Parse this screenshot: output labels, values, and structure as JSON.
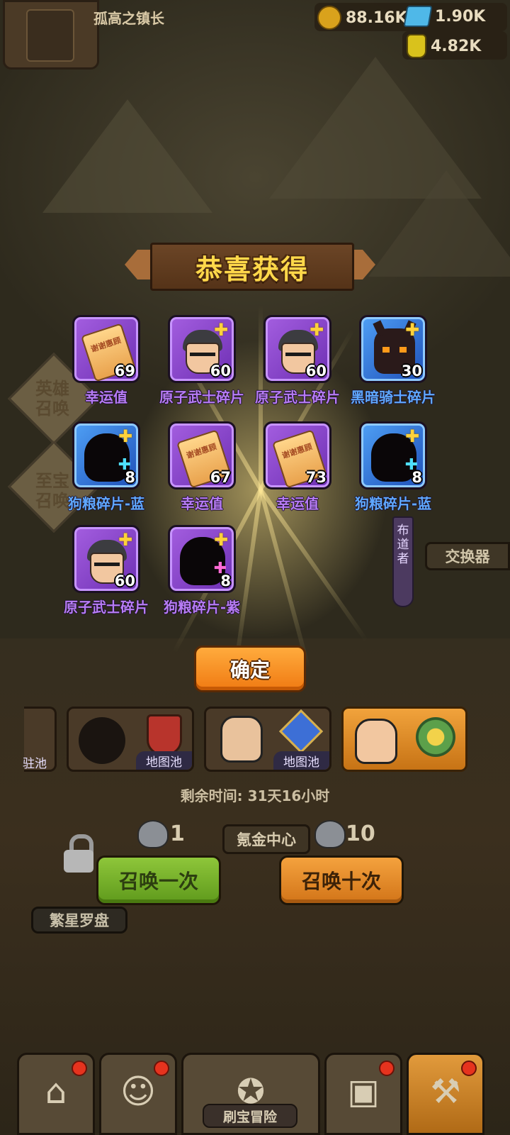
{
  "header": {
    "player_name": "孤高之镇长",
    "gold": "88.16K",
    "gems": "1.90K",
    "energy": "4.82K"
  },
  "dialog": {
    "title": "恭喜获得",
    "confirm_label": "确定",
    "rewards": [
      {
        "name": "幸运值",
        "count": "69",
        "rarity": "purple",
        "icon": "thanks-ticket-icon"
      },
      {
        "name": "原子武士碎片",
        "count": "60",
        "rarity": "purple",
        "icon": "atomic-warrior-icon"
      },
      {
        "name": "原子武士碎片",
        "count": "60",
        "rarity": "purple",
        "icon": "atomic-warrior-icon"
      },
      {
        "name": "黑暗骑士碎片",
        "count": "30",
        "rarity": "blue",
        "icon": "dark-knight-icon"
      },
      {
        "name": "狗粮碎片-蓝",
        "count": "8",
        "rarity": "blue",
        "icon": "silhouette-blue-icon"
      },
      {
        "name": "幸运值",
        "count": "67",
        "rarity": "purple",
        "icon": "thanks-ticket-icon"
      },
      {
        "name": "幸运值",
        "count": "73",
        "rarity": "purple",
        "icon": "thanks-ticket-icon"
      },
      {
        "name": "狗粮碎片-蓝",
        "count": "8",
        "rarity": "blue",
        "icon": "silhouette-blue-icon"
      },
      {
        "name": "原子武士碎片",
        "count": "60",
        "rarity": "purple",
        "icon": "atomic-warrior-icon"
      },
      {
        "name": "狗粮碎片-紫",
        "count": "8",
        "rarity": "purple",
        "icon": "silhouette-purple-icon"
      }
    ],
    "ticket_text": "谢谢惠顾"
  },
  "side": {
    "hero_summon": "英雄召唤",
    "treasure_summon": "至宝召唤",
    "preacher": "布道者",
    "exchanger": "交换器"
  },
  "pools": {
    "pool1_tag": "驻池",
    "pool2_tag": "地图池",
    "pool3_tag": "地图池"
  },
  "summon": {
    "remaining_time": "剩余时间: 31天16小时",
    "cost_one": "1",
    "cost_ten": "10",
    "shop_label": "氪金中心",
    "summon_one_label": "召唤一次",
    "summon_ten_label": "召唤十次",
    "compass_label": "繁星罗盘"
  },
  "nav": {
    "center_label": "刷宝冒险"
  },
  "colors": {
    "title_gold": "#ffd84a",
    "rarity_purple": "#a45ee0",
    "rarity_blue": "#4fa0f5",
    "confirm_orange": "#f07a12",
    "summon_green": "#8ec63a",
    "summon_orange": "#f4a23e"
  }
}
